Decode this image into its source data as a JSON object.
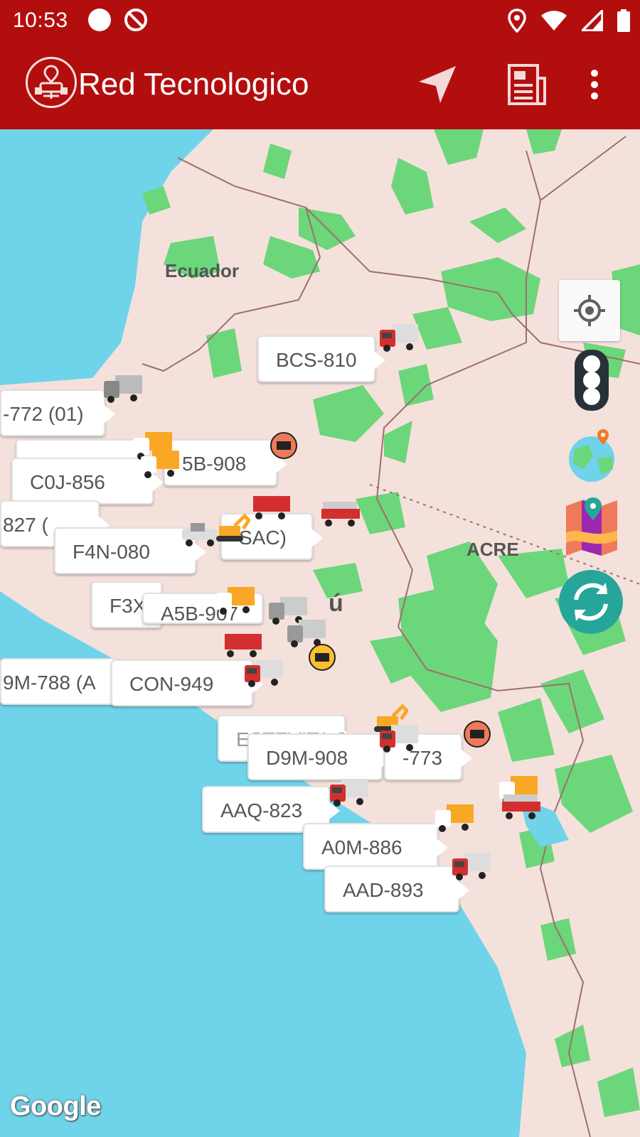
{
  "status": {
    "time": "10:53"
  },
  "appbar": {
    "title": "Red Tecnologico",
    "icons": [
      "logo-icon",
      "navigation-arrow-icon",
      "report-icon",
      "more-vert-icon"
    ]
  },
  "map": {
    "labels": {
      "ecuador": "Ecuador",
      "acre": "ACRE",
      "peru_fragment": "ú"
    },
    "callouts": [
      "BCS-810",
      "-772 (01)",
      "5B-908",
      "C0J-856",
      "827 (",
      "SAC)",
      "F4N-080",
      "F3X",
      "A5B-907",
      "9M-788 (A",
      "CON-949",
      "ESTEVITA S",
      "D9M-908",
      "-773",
      "AAQ-823",
      "A0M-886",
      "AAD-893"
    ],
    "attribution": "Google",
    "colors": {
      "water": "#6fd3ea",
      "land": "#f5e1dc",
      "forest": "#6cd67a",
      "brand": "#b30e0e",
      "refresh": "#26a69a"
    }
  }
}
